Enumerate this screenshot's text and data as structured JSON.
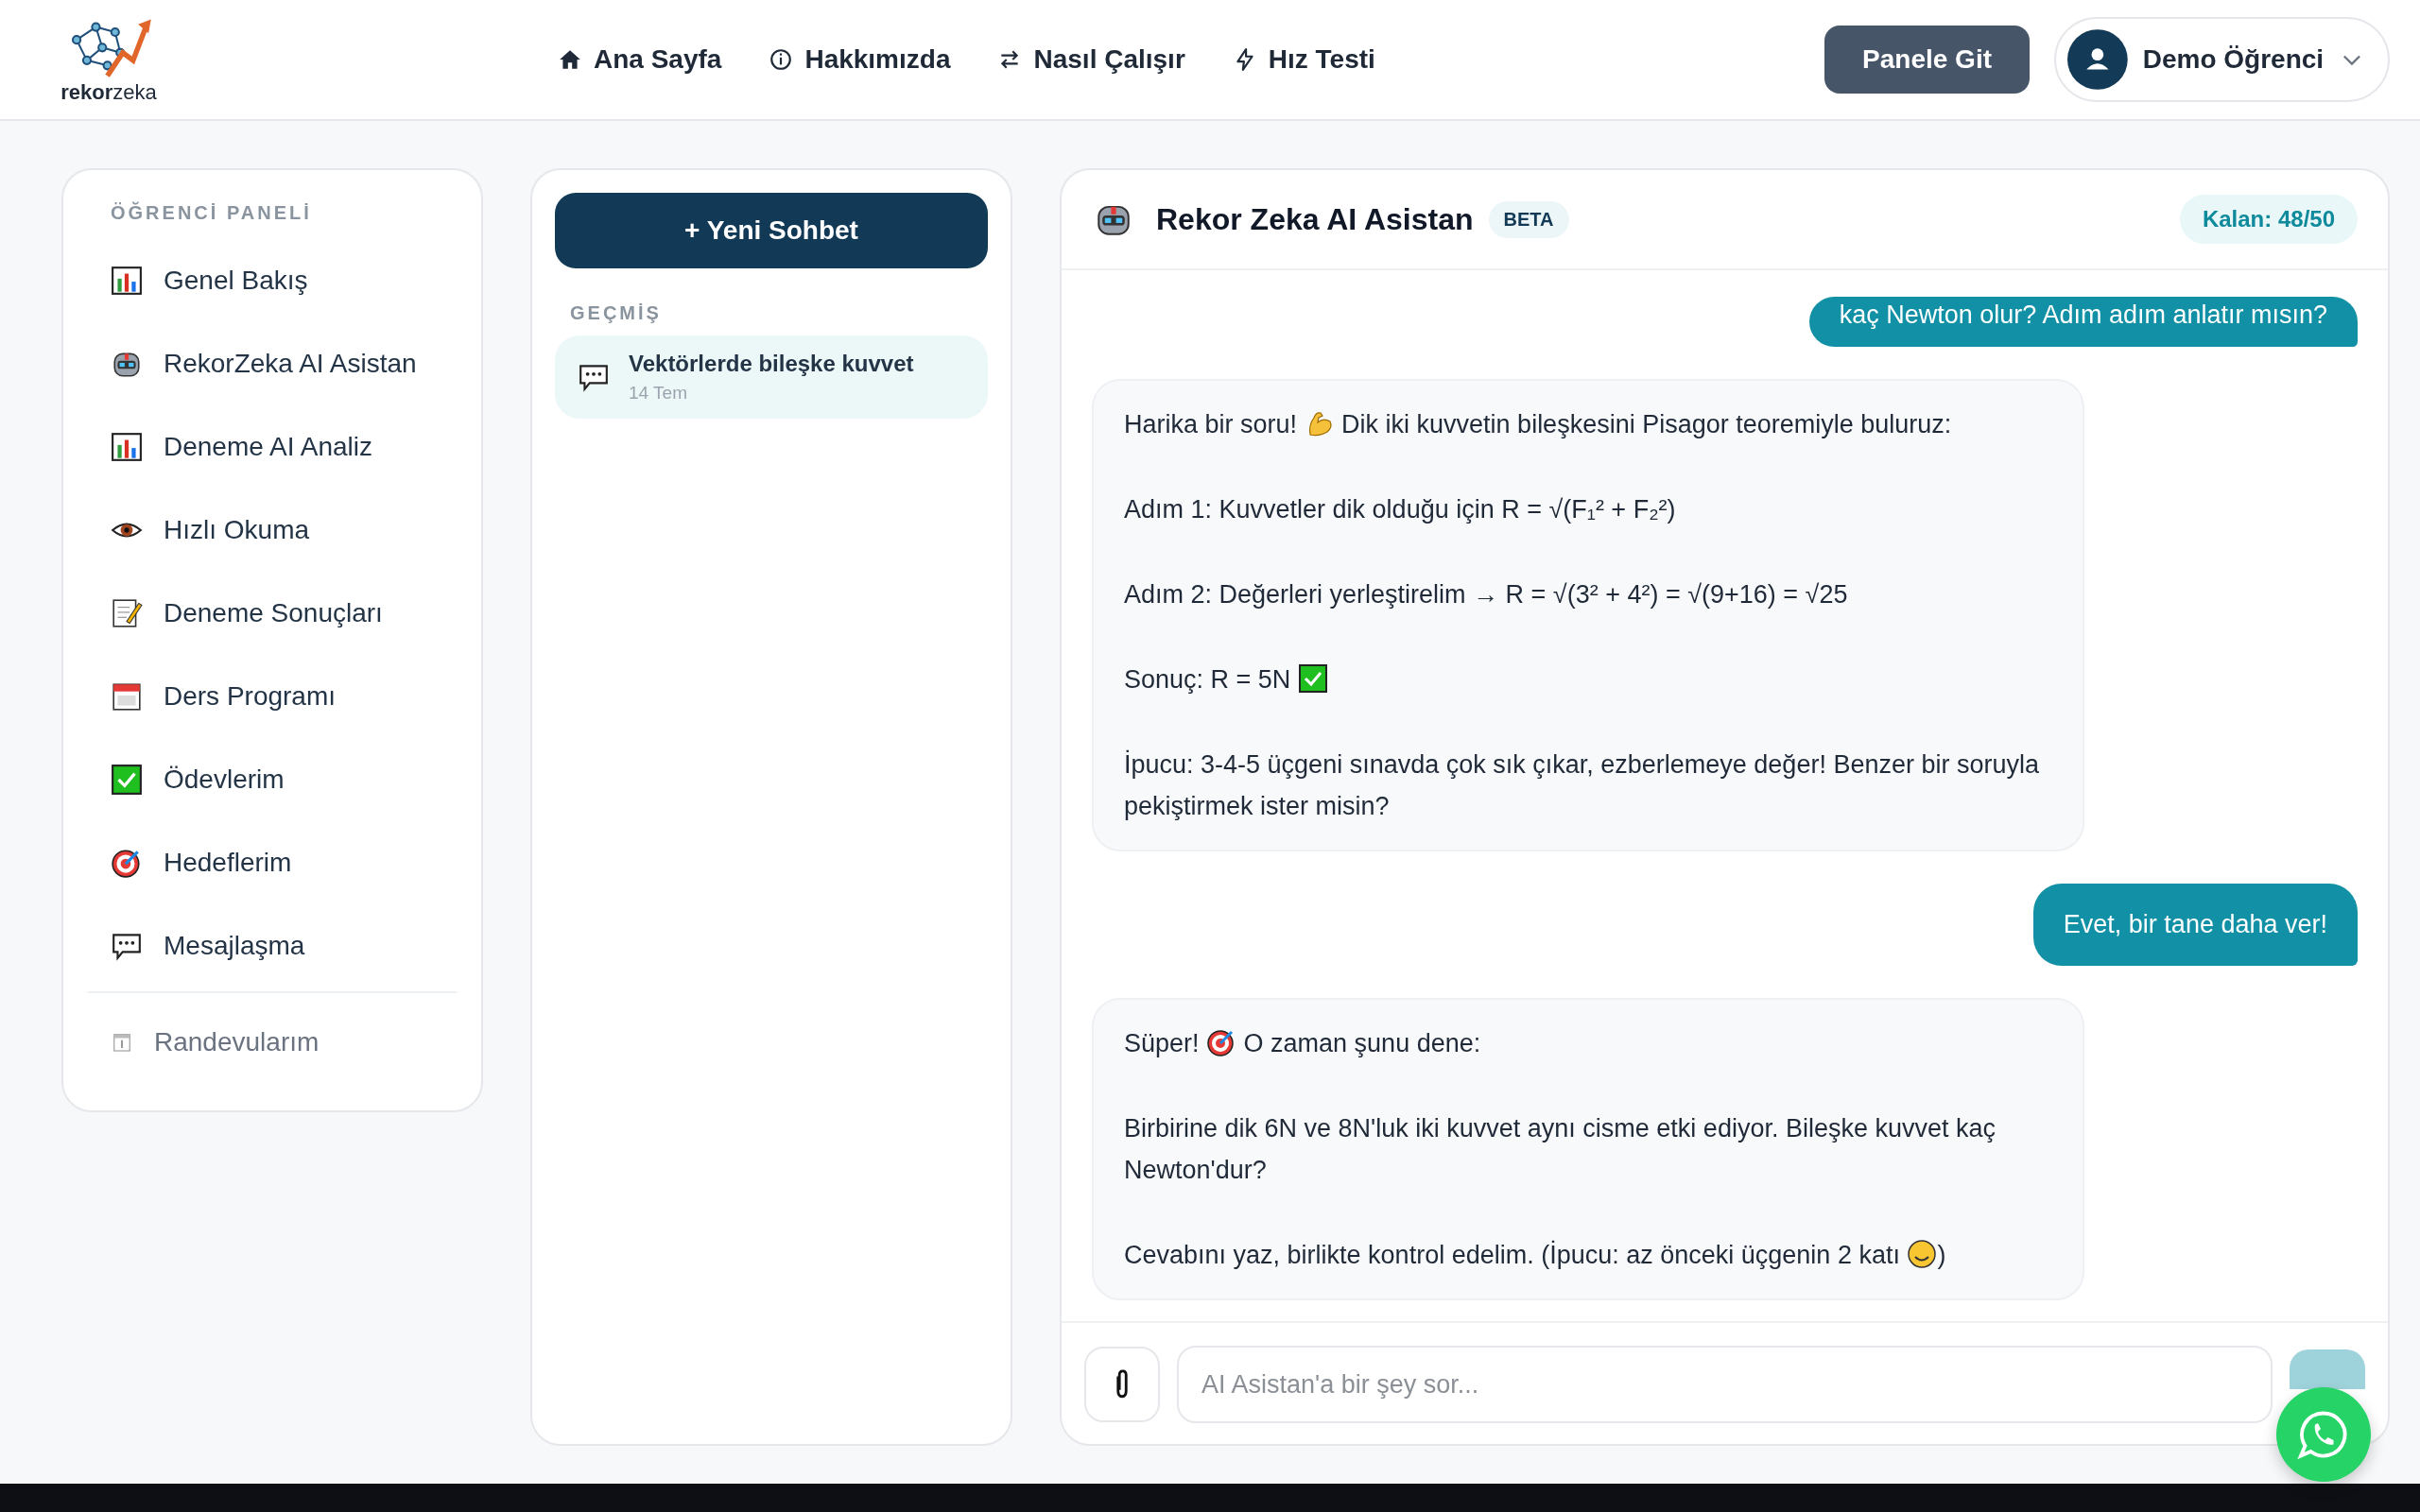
{
  "header": {
    "logo_text": "**rekor**zeka",
    "nav": [
      {
        "label": "Ana Sayfa",
        "kind": "home"
      },
      {
        "label": "Hakkımızda",
        "kind": "info"
      },
      {
        "label": "Nasıl Çalışır",
        "kind": "swap"
      },
      {
        "label": "Hız Testi",
        "kind": "bolt"
      }
    ],
    "panel_button": "Panele Git",
    "user": {
      "name": "Demo Öğrenci"
    }
  },
  "sidebar": {
    "title": "ÖĞRENCİ PANELİ",
    "items": [
      {
        "label": "Genel Bakış",
        "kind": "chart",
        "selected": false
      },
      {
        "label": "RekorZeka AI Asistan",
        "kind": "robot",
        "selected": false
      },
      {
        "label": "Deneme AI Analiz",
        "kind": "chart",
        "selected": false
      },
      {
        "label": "Hızlı Okuma",
        "kind": "eye",
        "selected": false
      },
      {
        "label": "Deneme Sonuçları",
        "kind": "memo",
        "selected": false
      },
      {
        "label": "Ders Programı",
        "kind": "calendar",
        "selected": false
      },
      {
        "label": "Ödevlerim",
        "kind": "check",
        "selected": false
      },
      {
        "label": "Hedeflerim",
        "kind": "target",
        "selected": false
      },
      {
        "label": "Mesajlaşma",
        "kind": "speech",
        "selected": false
      }
    ],
    "footer_items": [
      {
        "label": "Randevularım",
        "kind": "date"
      }
    ]
  },
  "history": {
    "new_chat_button": "+ Yeni Sohbet",
    "title": "GEÇMİŞ",
    "items": [
      {
        "title": "Vektörlerde bileşke kuvvet",
        "date": "14 Tem",
        "selected": true
      }
    ]
  },
  "chat": {
    "title": "Rekor Zeka AI Asistan",
    "badge": "BETA",
    "remaining": "Kalan: 48/50",
    "messages": [
      {
        "kind": "user",
        "paragraphs": [
          [
            {
              "text": "kaç Newton olur? Adım adım anlatır mısın?"
            }
          ]
        ]
      },
      {
        "kind": "assistant",
        "paragraphs": [
          [
            {
              "text": "Harika bir soru! "
            },
            {
              "kind": "flex"
            },
            {
              "text": " Dik iki kuvvetin bileşkesini Pisagor teoremiyle buluruz:"
            }
          ],
          [
            {
              "text": "Adım 1: Kuvvetler dik olduğu için R = √(F₁² + F₂²)"
            }
          ],
          [
            {
              "text": "Adım 2: Değerleri yerleştirelim → R = √(3² + 4²) = √(9+16) = √25"
            }
          ],
          [
            {
              "text": "Sonuç: R = 5N "
            },
            {
              "kind": "check"
            }
          ],
          [
            {
              "text": "İpucu: 3-4-5 üçgeni sınavda çok sık çıkar, ezberlemeye değer! Benzer bir soruyla pekiştirmek ister misin?"
            }
          ]
        ]
      },
      {
        "kind": "user",
        "paragraphs": [
          [
            {
              "text": "Evet, bir tane daha ver!"
            }
          ]
        ]
      },
      {
        "kind": "assistant",
        "paragraphs": [
          [
            {
              "text": "Süper! "
            },
            {
              "kind": "target"
            },
            {
              "text": " O zaman şunu dene:"
            }
          ],
          [
            {
              "text": "Birbirine dik 6N ve 8N'luk iki kuvvet aynı cisme etki ediyor. Bileşke kuvvet kaç Newton'dur?"
            }
          ],
          [
            {
              "text": "Cevabını yaz, birlikte kontrol edelim. (İpucu: az önceki üçgenin 2 katı "
            },
            {
              "kind": "wink"
            },
            {
              "text": ")"
            }
          ]
        ]
      }
    ],
    "input": {
      "placeholder": "AI Asistan'a bir şey sor..."
    }
  }
}
